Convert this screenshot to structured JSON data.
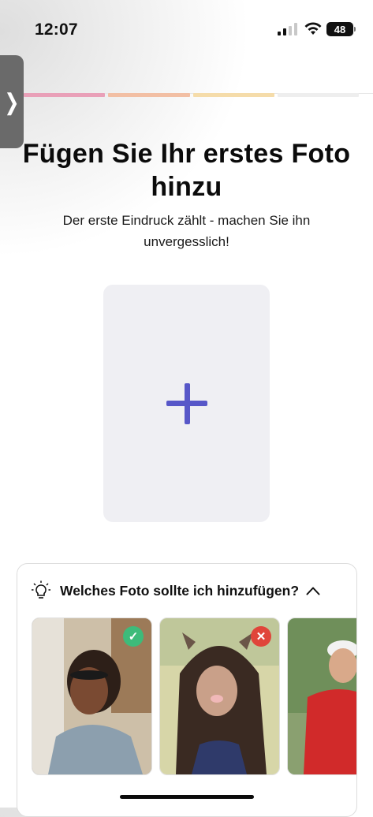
{
  "status_bar": {
    "time": "12:07",
    "battery": "48",
    "battery_level": 0.48
  },
  "side_handle": {
    "icon": "chevron-right-icon",
    "glyph": "❭"
  },
  "progress": {
    "steps": [
      "#e9a0b8",
      "#f2bfa4",
      "#f5dcaa",
      "#eeeeee"
    ]
  },
  "header": {
    "title": "Fügen Sie Ihr erstes Foto hinzu",
    "subtitle": "Der erste Eindruck zählt - machen Sie ihn unvergesslich!"
  },
  "add_photo": {
    "icon": "plus-icon",
    "color": "#5757c8"
  },
  "tips": {
    "title": "Welches Foto sollte ich hinzufügen?",
    "examples": [
      {
        "status": "good",
        "badge_color": "#3dbb7a"
      },
      {
        "status": "bad",
        "badge_color": "#e0453a"
      },
      {
        "status": "unknown"
      }
    ]
  }
}
